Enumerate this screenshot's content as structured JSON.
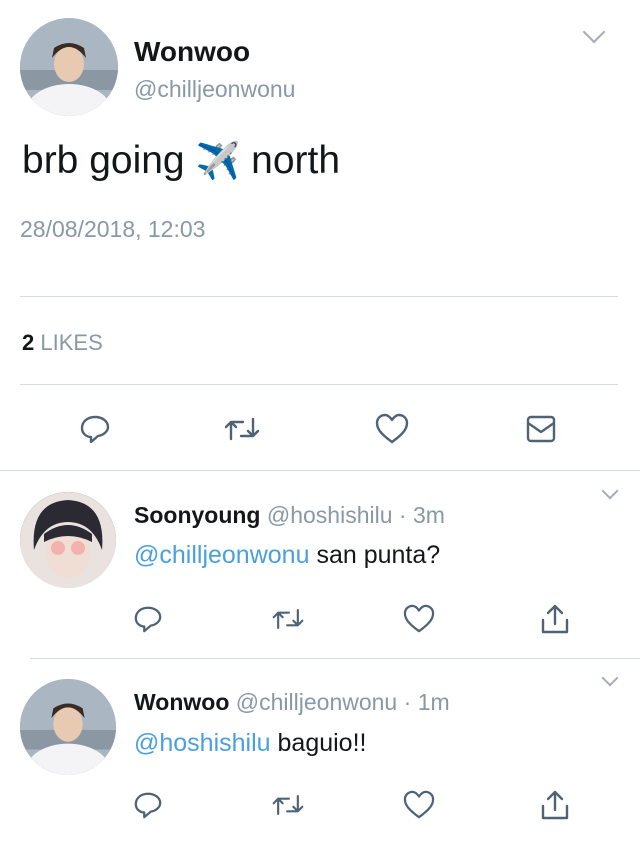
{
  "colors": {
    "link": "#4a9fe0",
    "muted": "#8899a6",
    "text": "#14171a",
    "divider": "#d6dbe0"
  },
  "main_tweet": {
    "author_name": "Wonwoo",
    "author_handle": "@chilljeonwonu",
    "text_before": "brb going",
    "emoji": "✈️",
    "text_after": "north",
    "timestamp": "28/08/2018, 12:03",
    "likes_count": "2",
    "likes_label": "LIKES",
    "actions": [
      "reply-icon",
      "retweet-icon",
      "like-icon",
      "message-icon"
    ]
  },
  "replies": [
    {
      "author_name": "Soonyoung",
      "author_handle": "@hoshishilu",
      "time": "3m",
      "mention": "@chilljeonwonu",
      "text": "san punta?",
      "actions": [
        "reply-icon",
        "retweet-icon",
        "like-icon",
        "share-icon"
      ]
    },
    {
      "author_name": "Wonwoo",
      "author_handle": "@chilljeonwonu",
      "time": "1m",
      "mention": "@hoshishilu",
      "text": "baguio!!",
      "actions": [
        "reply-icon",
        "retweet-icon",
        "like-icon",
        "share-icon"
      ]
    }
  ]
}
